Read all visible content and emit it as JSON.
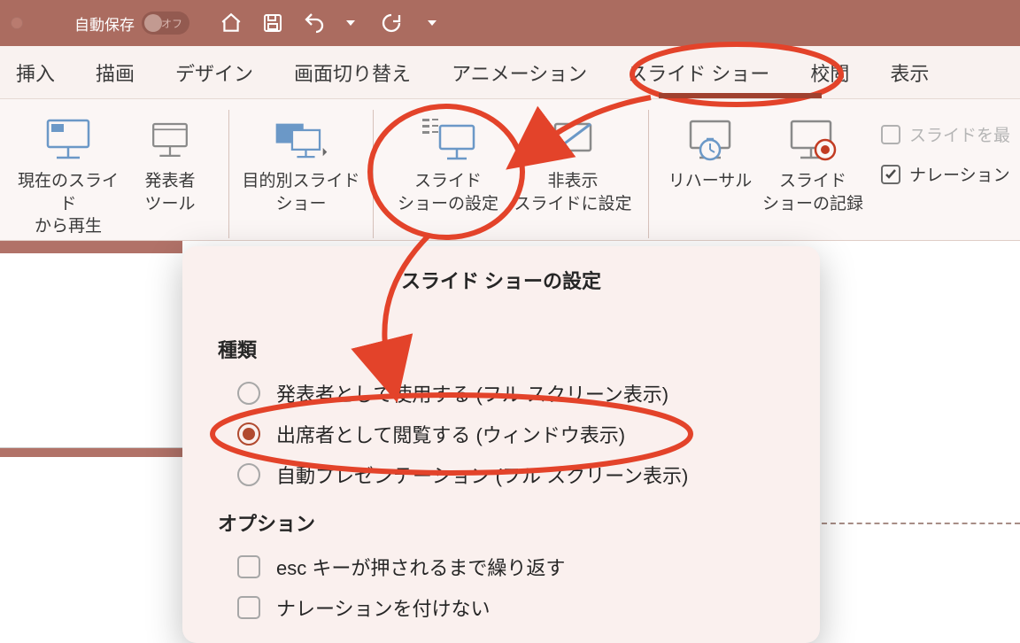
{
  "titlebar": {
    "autosave_label": "自動保存",
    "autosave_state": "オフ"
  },
  "tabs": {
    "insert": "挿入",
    "draw": "描画",
    "design": "デザイン",
    "transition": "画面切り替え",
    "animation": "アニメーション",
    "slideshow": "スライド ショー",
    "review": "校閲",
    "view": "表示"
  },
  "ribbon": {
    "from_current": {
      "line1": "現在のスライド",
      "line2": "から再生"
    },
    "presenter_tools": {
      "line1": "発表者",
      "line2": "ツール"
    },
    "custom_show": {
      "line1": "目的別スライド",
      "line2": "ショー"
    },
    "setup_show": {
      "line1": "スライド",
      "line2": "ショーの設定"
    },
    "hide_slide": {
      "line1": "非表示",
      "line2": "スライドに設定"
    },
    "rehearse": {
      "line1": "リハーサル"
    },
    "record": {
      "line1": "スライド",
      "line2": "ショーの記録"
    },
    "chk_keep_slides": "スライドを最",
    "chk_narration": "ナレーション"
  },
  "dialog": {
    "title": "スライド ショーの設定",
    "section_type": "種類",
    "type_presenter": "発表者として使用する (フル スクリーン表示)",
    "type_attendee": "出席者として閲覧する (ウィンドウ表示)",
    "type_auto": "自動プレゼンテーション (フル スクリーン表示)",
    "section_options": "オプション",
    "opt_loop": "esc キーが押されるまで繰り返す",
    "opt_no_narration": "ナレーションを付けない"
  }
}
